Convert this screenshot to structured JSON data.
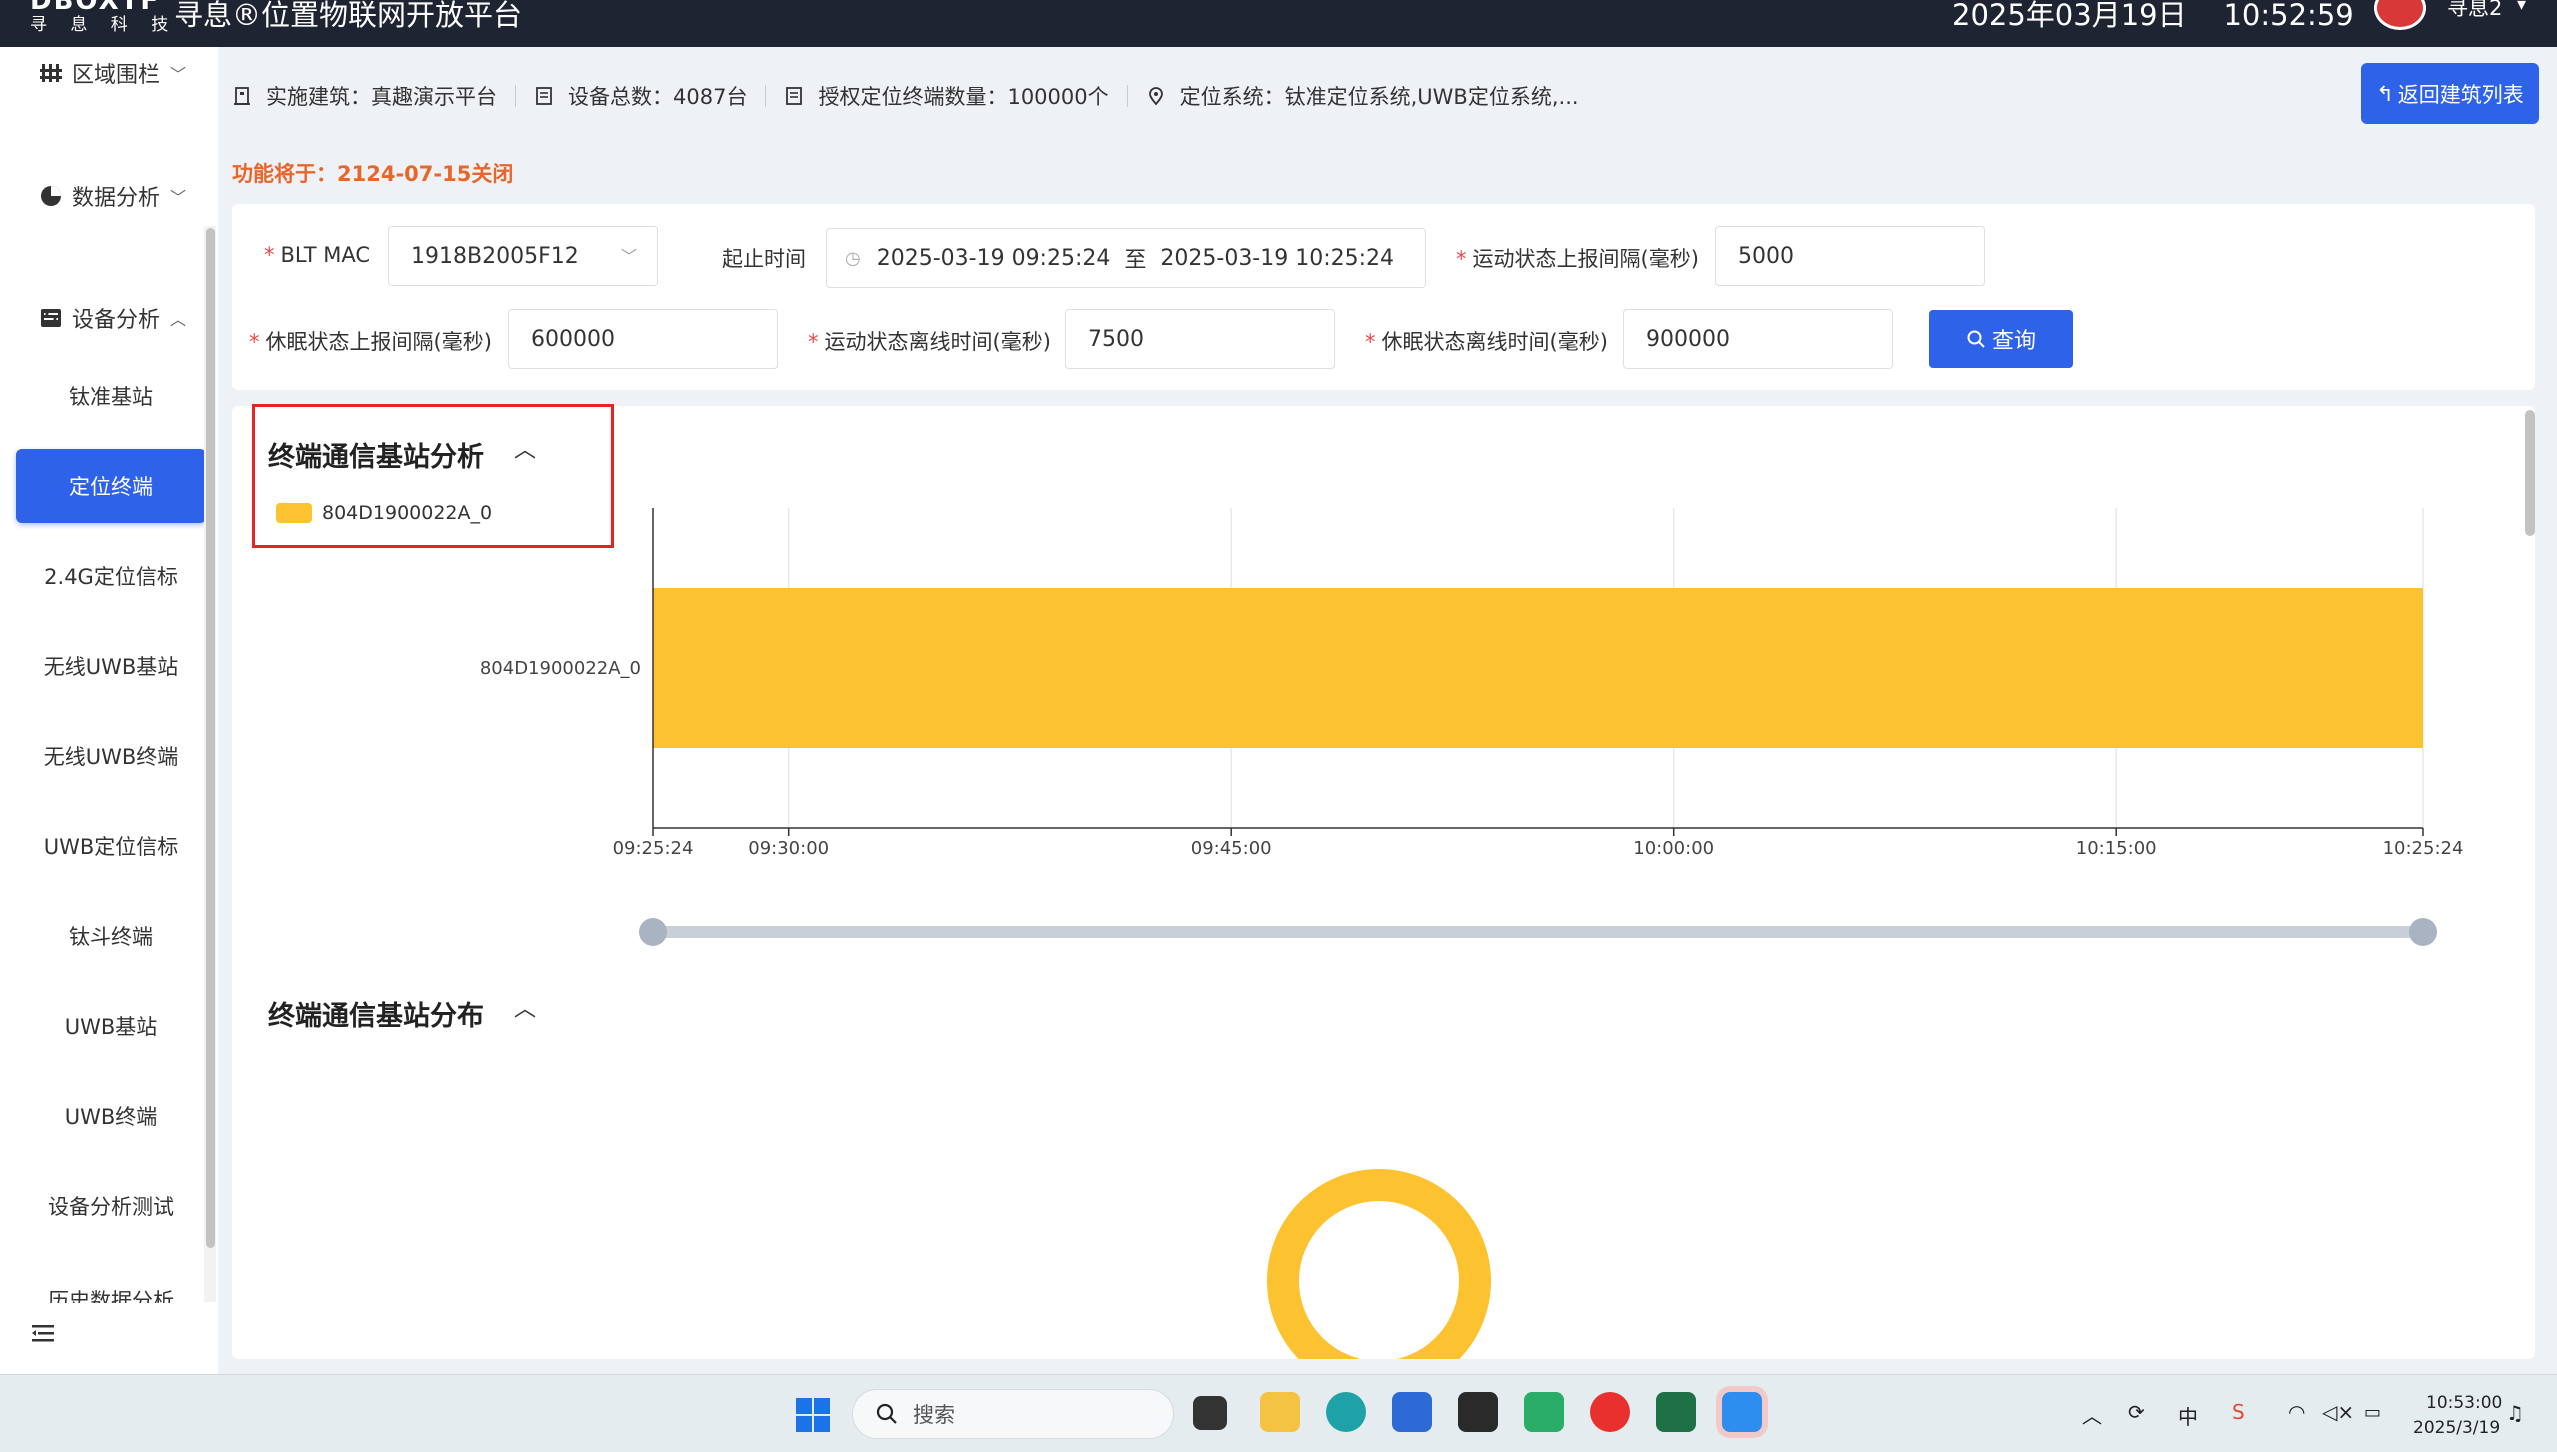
{
  "header": {
    "logo_main": "DBOXTF",
    "logo_sub": "寻 息 科 技",
    "app_title": "寻息®位置物联网开放平台",
    "date": "2025年03月19日",
    "time": "10:52:59",
    "user_name": "寻息2"
  },
  "sidebar": {
    "groups": [
      {
        "label": "区域围栏"
      },
      {
        "label": "数据分析"
      },
      {
        "label": "设备分析"
      }
    ],
    "items": [
      {
        "label": "钛准基站"
      },
      {
        "label": "定位终端",
        "active": true
      },
      {
        "label": "2.4G定位信标"
      },
      {
        "label": "无线UWB基站"
      },
      {
        "label": "无线UWB终端"
      },
      {
        "label": "UWB定位信标"
      },
      {
        "label": "钛斗终端"
      },
      {
        "label": "UWB基站"
      },
      {
        "label": "UWB终端"
      },
      {
        "label": "设备分析测试"
      },
      {
        "label": "历史数据分析"
      }
    ]
  },
  "infobar": {
    "building": "实施建筑：真趣演示平台",
    "device_total": "设备总数：4087台",
    "licensed": "授权定位终端数量：100000个",
    "positioning": "定位系统：钛准定位系统,UWB定位系统,...",
    "back_button": "返回建筑列表"
  },
  "notice": "功能将于：2124-07-15关闭",
  "filters": {
    "mac_label": "BLT MAC",
    "mac_value": "1918B2005F12",
    "time_label": "起止时间",
    "time_start": "2025-03-19 09:25:24",
    "time_sep": "至",
    "time_end": "2025-03-19 10:25:24",
    "move_interval_label": "运动状态上报间隔(毫秒)",
    "move_interval_value": "5000",
    "sleep_interval_label": "休眠状态上报间隔(毫秒)",
    "sleep_interval_value": "600000",
    "move_offline_label": "运动状态离线时间(毫秒)",
    "move_offline_value": "7500",
    "sleep_offline_label": "休眠状态离线时间(毫秒)",
    "sleep_offline_value": "900000",
    "query_button": "查询"
  },
  "section1_title": "终端通信基站分析",
  "section2_title": "终端通信基站分布",
  "colors": {
    "accent": "#2e62e8",
    "bar": "#fdc230",
    "notice": "#e8662a",
    "highlight": "#e8231f"
  },
  "chart_data": {
    "type": "bar",
    "orientation": "horizontal-timeline",
    "categories": [
      "804D1900022A_0"
    ],
    "series": [
      {
        "name": "804D1900022A_0",
        "start": "09:25:24",
        "end": "10:25:24"
      }
    ],
    "x_ticks": [
      "09:25:24",
      "09:30:00",
      "09:45:00",
      "10:00:00",
      "10:15:00",
      "10:25:24"
    ],
    "xlim": [
      "09:25:24",
      "10:25:24"
    ],
    "grid": true,
    "legend": "top-left",
    "slider_range": [
      0,
      1
    ]
  },
  "donut_chart": {
    "type": "pie",
    "values": [
      1
    ],
    "color": "#fdc230"
  },
  "taskbar": {
    "search_placeholder": "搜索",
    "ime": "中",
    "clock_time": "10:53:00",
    "clock_date": "2025/3/19"
  }
}
